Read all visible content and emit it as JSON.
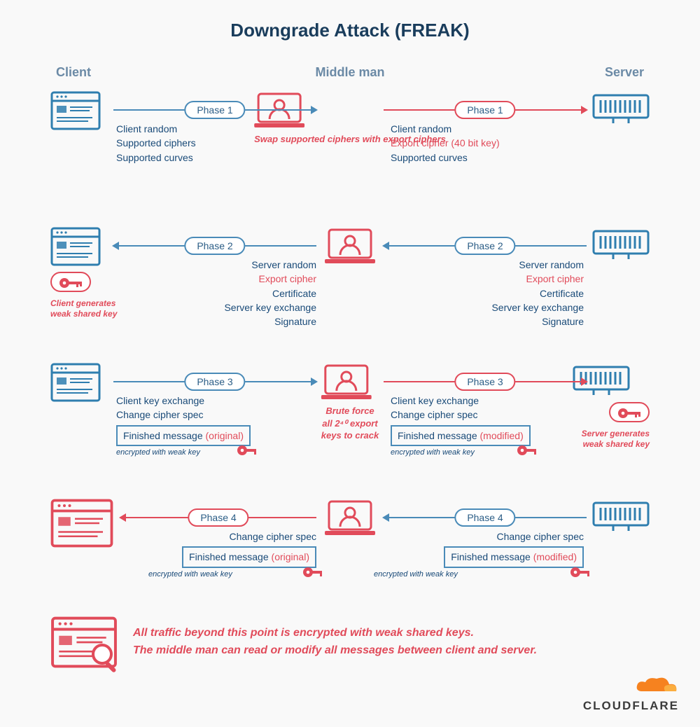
{
  "title": "Downgrade Attack (FREAK)",
  "columns": {
    "client": "Client",
    "middle": "Middle man",
    "server": "Server"
  },
  "phase_labels": {
    "p1": "Phase 1",
    "p2": "Phase 2",
    "p3": "Phase 3",
    "p4": "Phase 4"
  },
  "row1": {
    "left_msgs": [
      "Client random",
      "Supported ciphers",
      "Supported curves"
    ],
    "mid_note": "Swap supported ciphers with export ciphers",
    "right_msgs": [
      "Client random",
      "Export cipher (40 bit key)",
      "Supported curves"
    ],
    "right_red_index": 1
  },
  "row2": {
    "left_msgs": [
      "Server random",
      "Export cipher",
      "Certificate",
      "Server key exchange",
      "Signature"
    ],
    "left_red_index": 1,
    "client_note": "Client generates weak shared key",
    "right_msgs": [
      "Server random",
      "Export cipher",
      "Certificate",
      "Server key exchange",
      "Signature"
    ],
    "right_red_index": 1
  },
  "row3": {
    "left_msgs": [
      "Client key exchange",
      "Change cipher spec"
    ],
    "left_boxed": "Finished message",
    "left_boxed_paren": "(original)",
    "enc_sub": "encrypted with weak key",
    "mid_note_a": "Brute force",
    "mid_note_b": "all 2⁴⁰ export",
    "mid_note_c": "keys to crack",
    "right_msgs": [
      "Client key exchange",
      "Change cipher spec"
    ],
    "right_boxed": "Finished message",
    "right_boxed_paren": "(modified)",
    "server_note": "Server generates weak shared key"
  },
  "row4": {
    "left_msgs": [
      "Change cipher spec"
    ],
    "left_boxed": "Finished message",
    "left_boxed_paren": "(original)",
    "enc_sub": "encrypted with weak key",
    "right_msgs": [
      "Change cipher spec"
    ],
    "right_boxed": "Finished message",
    "right_boxed_paren": "(modified)"
  },
  "footer": {
    "line1": "All traffic beyond this point is encrypted with weak shared keys.",
    "line2": "The middle man can read or modify all messages between client and server."
  },
  "brand": "CLOUDFLARE"
}
